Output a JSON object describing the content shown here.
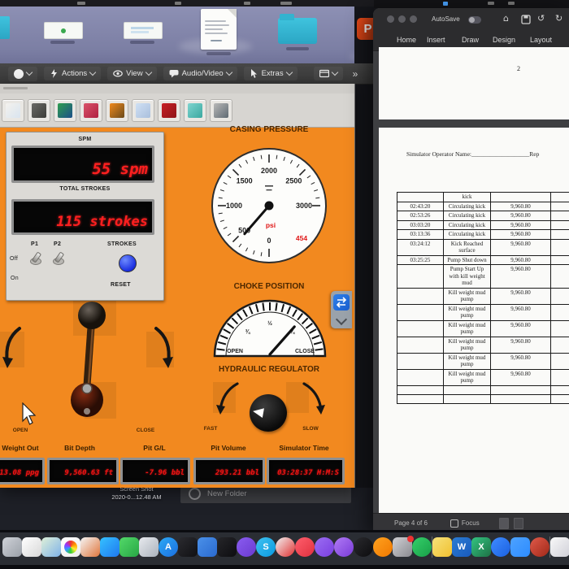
{
  "remote_toolbar": {
    "menu_items": [
      {
        "label": "Actions"
      },
      {
        "label": "View"
      },
      {
        "label": "Audio/Video"
      },
      {
        "label": "Extras"
      }
    ],
    "more_glyph": "»"
  },
  "app_toolbar": {
    "buttons": [
      {
        "name": "well-schematic",
        "c1": "#f4f2ee",
        "c2": "#d9e4ef"
      },
      {
        "name": "pump-unit",
        "c1": "#6a6a66",
        "c2": "#3c3c38"
      },
      {
        "name": "bop-stack",
        "c1": "#2f9e4f",
        "c2": "#1d4f8a"
      },
      {
        "name": "mud-pits",
        "c1": "#d9536a",
        "c2": "#b02040"
      },
      {
        "name": "choke-panel",
        "c1": "#f08a1e",
        "c2": "#6b4a1a"
      },
      {
        "name": "graph-window",
        "c1": "#cfe0f4",
        "c2": "#aabfdc"
      },
      {
        "name": "kill-sheet",
        "c1": "#c81f25",
        "c2": "#8f1418"
      },
      {
        "name": "strip-chart",
        "c1": "#7fd4cf",
        "c2": "#3aa8a0"
      },
      {
        "name": "monitor-view",
        "c1": "#b9b9b9",
        "c2": "#5f6a72"
      }
    ]
  },
  "simulator": {
    "pump_panel": {
      "spm_label": "SPM",
      "spm_value": "55 spm",
      "total_strokes_label": "TOTAL STROKES",
      "strokes_value": "115 strokes",
      "p1_label": "P1",
      "p2_label": "P2",
      "off_label": "Off",
      "on_label": "On",
      "strokes_label": "STROKES",
      "reset_label": "RESET"
    },
    "casing_gauge": {
      "title": "CASING PRESSURE",
      "min": 0,
      "max": 3000,
      "major_step": 500,
      "minor_step": 100,
      "tick_values": [
        0,
        500,
        1000,
        1500,
        2000,
        2500,
        3000
      ],
      "value": 454,
      "unit": "psi"
    },
    "choke_gauge": {
      "title": "CHOKE POSITION",
      "open_label": "OPEN",
      "close_label": "CLOSE",
      "fractions": [
        {
          "t": "¾",
          "deg": 132
        },
        {
          "t": "½",
          "deg": 90
        },
        {
          "t": "¼",
          "deg": 48
        }
      ],
      "needle_deg": 50
    },
    "regulator": {
      "title": "HYDRAULIC REGULATOR",
      "fast_label": "FAST",
      "slow_label": "SLOW"
    },
    "lever": {
      "open_label": "OPEN",
      "close_label": "CLOSE"
    },
    "readouts": [
      {
        "label": "Weight Out",
        "value": "13.08 ppg"
      },
      {
        "label": "Bit Depth",
        "value": "9,560.63 ft"
      },
      {
        "label": "Pit G/L",
        "value": "-7.96 bbl"
      },
      {
        "label": "Pit Volume",
        "value": "293.21 bbl"
      },
      {
        "label": "Simulator Time",
        "value": "03:28:37 H:M:S"
      }
    ]
  },
  "desktop": {
    "powerpoint_letter": "P",
    "screenshot_label_line1": "Screen Shot",
    "screenshot_label_line2": "2020-0...12.48 AM",
    "new_folder_label": "New Folder"
  },
  "word": {
    "autosave_label": "AutoSave",
    "icons": {
      "home": "⌂",
      "undo": "↺",
      "redo": "↻"
    },
    "ribbon_tabs": [
      "Home",
      "Insert",
      "Draw",
      "Design",
      "Layout"
    ],
    "page_number_fragment": "2",
    "operator_label": "Simulator Operator Name:",
    "operator_blank": "___________________",
    "operator_right_fragment": "Rep",
    "table_rows": [
      {
        "time": "",
        "event": "kick",
        "depth": ""
      },
      {
        "time": "02:43:20",
        "event": "Circulating kick",
        "depth": "9,960.80"
      },
      {
        "time": "02:53:26",
        "event": "Circulating kick",
        "depth": "9,960.80"
      },
      {
        "time": "03:03:20",
        "event": "Circulating kick",
        "depth": "9,960.80"
      },
      {
        "time": "03:13:36",
        "event": "Circulating kick",
        "depth": "9,960.80"
      },
      {
        "time": "03:24:12",
        "event": "Kick Reached surface",
        "depth": "9,960.80"
      },
      {
        "time": "03:25:25",
        "event": "Pump Shut down",
        "depth": "9,960.80"
      },
      {
        "time": "",
        "event": "Pump Start Up with kill weight mud",
        "depth": "9,960.80"
      },
      {
        "time": "",
        "event": "Kill weight mud pump",
        "depth": "9,960.80"
      },
      {
        "time": "",
        "event": "Kill weight mud pump",
        "depth": "9,960.80"
      },
      {
        "time": "",
        "event": "Kill weight mud pump",
        "depth": "9,960.80"
      },
      {
        "time": "",
        "event": "Kill weight mud pump",
        "depth": "9,960.80"
      },
      {
        "time": "",
        "event": "Kill weight mud pump",
        "depth": "9,960.80"
      },
      {
        "time": "",
        "event": "Kill weight mud pump",
        "depth": "9,960.80"
      },
      {
        "time": "",
        "event": "",
        "depth": ""
      },
      {
        "time": "",
        "event": "",
        "depth": ""
      }
    ],
    "status": {
      "page": "Page 4 of 6",
      "focus": "Focus"
    }
  },
  "dock": {
    "items": [
      {
        "n": "finder",
        "c1": "#cfd2d8",
        "c2": "#9aa0a8",
        "shape": "square"
      },
      {
        "n": "textedit",
        "c1": "#ffffff",
        "c2": "#d8d8d8",
        "shape": "square"
      },
      {
        "n": "maps",
        "c1": "#dff0d8",
        "c2": "#7fb2e8",
        "shape": "square"
      },
      {
        "n": "photos",
        "c1": "#ffffff",
        "c2": "#ececec",
        "shape": "square",
        "wheel": true
      },
      {
        "n": "launchpad",
        "c1": "#f5f5f5",
        "c2": "#e0763c",
        "shape": "square"
      },
      {
        "n": "messages",
        "c1": "#35c1ff",
        "c2": "#1f78f0",
        "shape": "square"
      },
      {
        "n": "green-chat",
        "c1": "#52d869",
        "c2": "#28a745",
        "shape": "square"
      },
      {
        "n": "preview",
        "c1": "#e8eaee",
        "c2": "#aab2bc",
        "shape": "square"
      },
      {
        "n": "app-store",
        "c1": "#2da9f5",
        "c2": "#1b6fe0",
        "shape": "circle",
        "letter": "A"
      },
      {
        "n": "stocks",
        "c1": "#2b2b30",
        "c2": "#101013",
        "shape": "square"
      },
      {
        "n": "keynote",
        "c1": "#4a90e8",
        "c2": "#2a6ad0",
        "shape": "square"
      },
      {
        "n": "dark-grid-app",
        "c1": "#26262a",
        "c2": "#0d0d10",
        "shape": "square"
      },
      {
        "n": "star-app",
        "c1": "#8a5cf0",
        "c2": "#6a3ad0",
        "shape": "circle"
      },
      {
        "n": "skype",
        "c1": "#3fc1f0",
        "c2": "#0a9ae0",
        "shape": "circle",
        "letter": "S"
      },
      {
        "n": "red-slash-app",
        "c1": "#f2f2f2",
        "c2": "#e03131",
        "shape": "circle"
      },
      {
        "n": "music",
        "c1": "#ff5f6d",
        "c2": "#e0303e",
        "shape": "circle"
      },
      {
        "n": "purple-app",
        "c1": "#9b6df2",
        "c2": "#7a3fe0",
        "shape": "circle"
      },
      {
        "n": "podcasts",
        "c1": "#b07af5",
        "c2": "#7a3bd8",
        "shape": "circle"
      },
      {
        "n": "tv",
        "c1": "#2a2a2e",
        "c2": "#0c0c0e",
        "shape": "circle"
      },
      {
        "n": "books",
        "c1": "#ffa21f",
        "c2": "#f07800",
        "shape": "circle"
      },
      {
        "n": "settings",
        "c1": "#d0d0d4",
        "c2": "#8a8a90",
        "shape": "square",
        "badge": true
      },
      {
        "n": "green-ring-app",
        "c1": "#35d06a",
        "c2": "#18a048",
        "shape": "circle"
      },
      {
        "sep": true
      },
      {
        "n": "notes",
        "c1": "#f7e27a",
        "c2": "#f0c030",
        "shape": "square"
      },
      {
        "n": "word",
        "c1": "#2b7cd3",
        "c2": "#185abd",
        "shape": "square",
        "letter": "W"
      },
      {
        "n": "excel",
        "c1": "#33c481",
        "c2": "#1e7145",
        "shape": "square",
        "letter": "X"
      },
      {
        "n": "teamviewer",
        "c1": "#3f8cff",
        "c2": "#1a60e0",
        "shape": "circle"
      },
      {
        "n": "zoom",
        "c1": "#4da2ff",
        "c2": "#2d8cff",
        "shape": "square"
      },
      {
        "n": "red-sphere-app",
        "c1": "#e05a4a",
        "c2": "#a02818",
        "shape": "circle"
      },
      {
        "sep": true
      },
      {
        "n": "screenshot-thumb",
        "c1": "#f8f8f8",
        "c2": "#d0d0d8",
        "shape": "square"
      }
    ]
  }
}
